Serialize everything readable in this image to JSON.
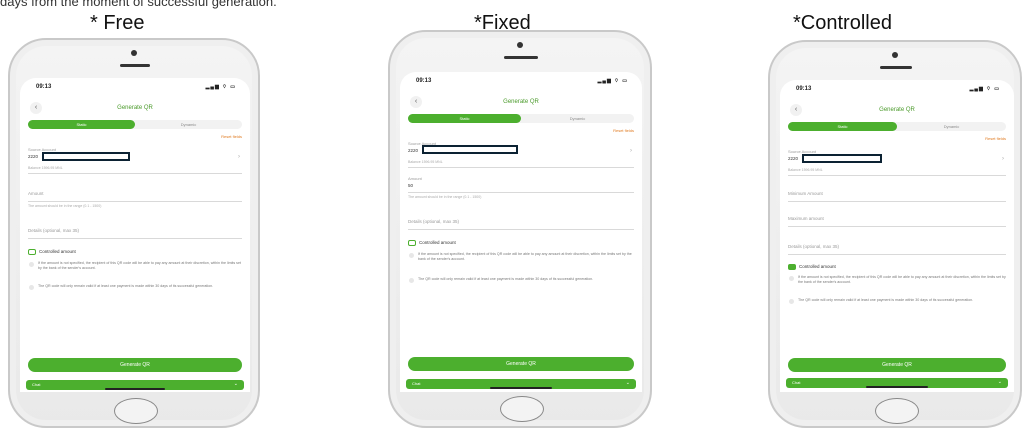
{
  "caption": "days from the moment of successful generation.",
  "panels": [
    {
      "mode_title": "* Free",
      "status_time": "09:13",
      "status_icons": "▂▄▆ ⌔ ▭",
      "back_glyph": "‹",
      "screen_title": "Generate QR",
      "tab_static": "Static",
      "tab_dynamic": "Dynamic",
      "reset_label": "Reset fields",
      "source_label": "Source Account",
      "source_value": "2220",
      "balance": "Balance 1596.95 MNL",
      "amount_label": "Amount",
      "amount_hint": "The amount should be in the range (0.1 - 1500)",
      "details_placeholder": "Details (optional, max 35)",
      "controlled_label": "Controlled amount",
      "note1": "If the amount is not specified, the recipient of this QR code will be able to pay any amount at their discretion, within the limits set by the bank of the sender's account.",
      "note2": "The QR code will only remain valid if at least one payment is made within 30 days of its successful generation.",
      "generate_label": "Generate QR",
      "chat_label": "Chat",
      "chat_arrow": "⌄"
    },
    {
      "mode_title": "*Fixed",
      "status_time": "09:13",
      "status_icons": "▂▄▆ ⌔ ▭",
      "back_glyph": "‹",
      "screen_title": "Generate QR",
      "tab_static": "Static",
      "tab_dynamic": "Dynamic",
      "reset_label": "Reset fields",
      "source_label": "Source Account",
      "source_value": "2220",
      "balance": "Balance 1596.95 MNL",
      "amount_label": "Amount",
      "amount_value": "50",
      "amount_hint": "The amount should be in the range (0.1 - 1500)",
      "details_placeholder": "Details (optional, max 35)",
      "controlled_label": "Controlled amount",
      "note1": "If the amount is not specified, the recipient of this QR code will be able to pay any amount at their discretion, within the limits set by the bank of the sender's account.",
      "note2": "The QR code will only remain valid if at least one payment is made within 30 days of its successful generation.",
      "generate_label": "Generate QR",
      "chat_label": "Chat",
      "chat_arrow": "⌄"
    },
    {
      "mode_title": "*Controlled",
      "status_time": "09:13",
      "status_icons": "▂▄▆ ⌔ ▭",
      "back_glyph": "‹",
      "screen_title": "Generate QR",
      "tab_static": "Static",
      "tab_dynamic": "Dynamic",
      "reset_label": "Reset fields",
      "source_label": "Source Account",
      "source_value": "2220",
      "balance": "Balance 1596.95 MNL",
      "min_label": "Minimum Amount",
      "max_label": "Maximum amount",
      "details_placeholder": "Details (optional, max 35)",
      "controlled_label": "Controlled amount",
      "note1": "If the amount is not specified, the recipient of this QR code will be able to pay any amount at their discretion, within the limits set by the bank of the sender's account.",
      "note2": "The QR code will only remain valid if at least one payment is made within 30 days of its successful generation.",
      "generate_label": "Generate QR",
      "chat_label": "Chat",
      "chat_arrow": "⌄"
    }
  ],
  "colors": {
    "accent_green": "#4caf2e",
    "reset_orange": "#e07b22",
    "redaction_border": "#0c2233"
  }
}
